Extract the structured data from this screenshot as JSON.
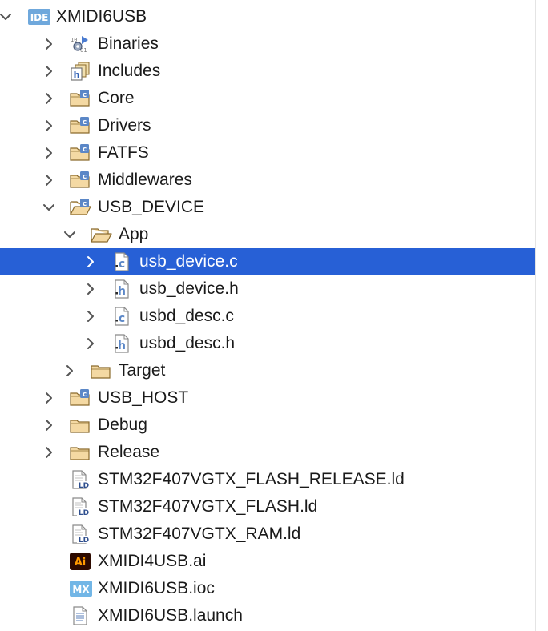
{
  "colors": {
    "selection": "#2760d6",
    "folder_fill": "#f4d9a3",
    "folder_stroke": "#8a6a2c",
    "source_badge": "#5b87c7",
    "ide_badge": "#6fa8dc",
    "ai_badge": "#2d0a00",
    "ai_text": "#ff9a00",
    "mx_badge": "#72b6e6"
  },
  "tree": [
    {
      "label": "XMIDI6USB",
      "depth": 0,
      "chevron": "down",
      "icon": "ide-project-icon",
      "selected": false
    },
    {
      "label": "Binaries",
      "depth": 1,
      "chevron": "right",
      "icon": "binaries-icon",
      "selected": false
    },
    {
      "label": "Includes",
      "depth": 1,
      "chevron": "right",
      "icon": "includes-icon",
      "selected": false
    },
    {
      "label": "Core",
      "depth": 1,
      "chevron": "right",
      "icon": "source-folder-icon",
      "selected": false
    },
    {
      "label": "Drivers",
      "depth": 1,
      "chevron": "right",
      "icon": "source-folder-icon",
      "selected": false
    },
    {
      "label": "FATFS",
      "depth": 1,
      "chevron": "right",
      "icon": "source-folder-icon",
      "selected": false
    },
    {
      "label": "Middlewares",
      "depth": 1,
      "chevron": "right",
      "icon": "source-folder-icon",
      "selected": false
    },
    {
      "label": "USB_DEVICE",
      "depth": 1,
      "chevron": "down",
      "icon": "source-folder-open-icon",
      "selected": false
    },
    {
      "label": "App",
      "depth": 2,
      "chevron": "down",
      "icon": "folder-open-icon",
      "selected": false
    },
    {
      "label": "usb_device.c",
      "depth": 3,
      "chevron": "right",
      "icon": "c-file-icon",
      "selected": true
    },
    {
      "label": "usb_device.h",
      "depth": 3,
      "chevron": "right",
      "icon": "h-file-icon",
      "selected": false
    },
    {
      "label": "usbd_desc.c",
      "depth": 3,
      "chevron": "right",
      "icon": "c-file-icon",
      "selected": false
    },
    {
      "label": "usbd_desc.h",
      "depth": 3,
      "chevron": "right",
      "icon": "h-file-icon",
      "selected": false
    },
    {
      "label": "Target",
      "depth": 2,
      "chevron": "right",
      "icon": "folder-icon",
      "selected": false
    },
    {
      "label": "USB_HOST",
      "depth": 1,
      "chevron": "right",
      "icon": "source-folder-icon",
      "selected": false
    },
    {
      "label": "Debug",
      "depth": 1,
      "chevron": "right",
      "icon": "folder-icon",
      "selected": false
    },
    {
      "label": "Release",
      "depth": 1,
      "chevron": "right",
      "icon": "folder-icon",
      "selected": false
    },
    {
      "label": "STM32F407VGTX_FLASH_RELEASE.ld",
      "depth": 1,
      "chevron": "none",
      "icon": "linker-file-icon",
      "selected": false
    },
    {
      "label": "STM32F407VGTX_FLASH.ld",
      "depth": 1,
      "chevron": "none",
      "icon": "linker-file-icon",
      "selected": false
    },
    {
      "label": "STM32F407VGTX_RAM.ld",
      "depth": 1,
      "chevron": "none",
      "icon": "linker-file-icon",
      "selected": false
    },
    {
      "label": "XMIDI4USB.ai",
      "depth": 1,
      "chevron": "none",
      "icon": "illustrator-file-icon",
      "selected": false
    },
    {
      "label": "XMIDI6USB.ioc",
      "depth": 1,
      "chevron": "none",
      "icon": "mx-file-icon",
      "selected": false
    },
    {
      "label": "XMIDI6USB.launch",
      "depth": 1,
      "chevron": "none",
      "icon": "launch-file-icon",
      "selected": false
    }
  ]
}
